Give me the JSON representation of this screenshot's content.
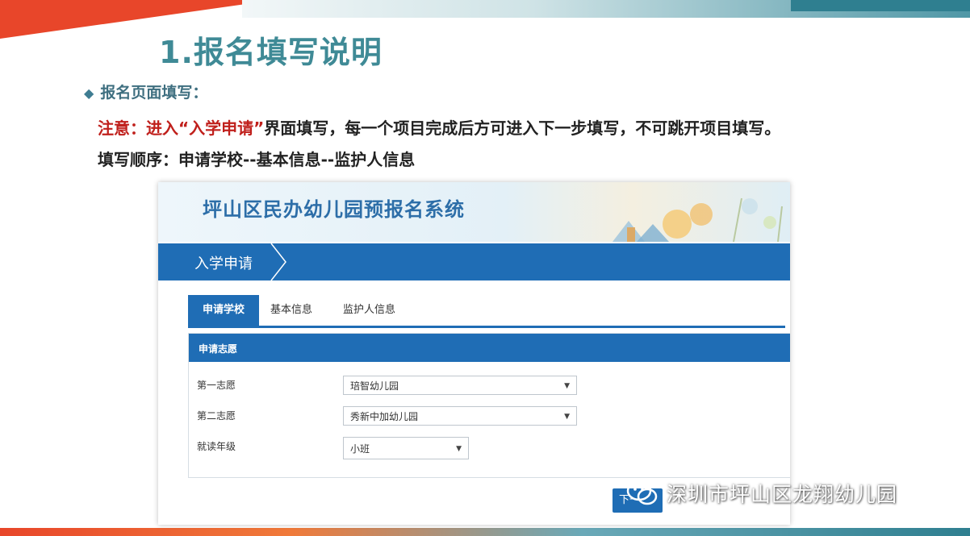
{
  "slide": {
    "title": "1.报名填写说明",
    "bullet": "报名页面填写：",
    "note_prefix": "注意：进入",
    "note_highlight": "“入学申请”",
    "note_suffix": "界面填写，每一个项目完成后方可进入下一步填写，不可跳开项目填写。",
    "order": "填写顺序：申请学校--基本信息--监护人信息"
  },
  "app": {
    "system_title": "坪山区民办幼儿园预报名系统",
    "breadcrumb": "入学申请",
    "tabs": [
      {
        "label": "申请学校",
        "active": true
      },
      {
        "label": "基本信息",
        "active": false
      },
      {
        "label": "监护人信息",
        "active": false
      }
    ],
    "panel_title": "申请志愿",
    "fields": [
      {
        "label": "第一志愿",
        "value": "琣智幼儿园"
      },
      {
        "label": "第二志愿",
        "value": "秀新中加幼儿园"
      },
      {
        "label": "就读年级",
        "value": "小班"
      }
    ],
    "next_button": "下一"
  },
  "watermark": "深圳市坪山区龙翔幼儿园",
  "colors": {
    "accent_blue": "#1f6db5",
    "title_teal": "#3f8a96",
    "highlight_red": "#c0201c"
  }
}
